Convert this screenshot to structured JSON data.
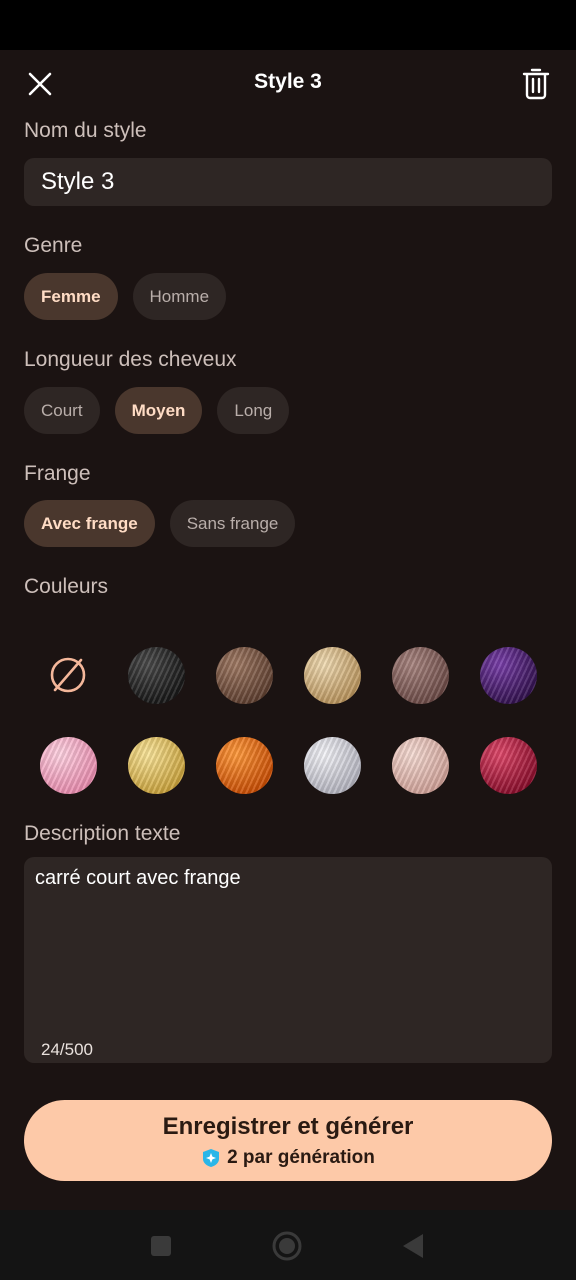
{
  "header": {
    "title": "Style 3",
    "close_icon": "close-icon",
    "delete_icon": "trash-icon"
  },
  "name_section": {
    "label": "Nom du style",
    "value": "Style 3"
  },
  "gender_section": {
    "label": "Genre",
    "options": [
      {
        "label": "Femme",
        "selected": true
      },
      {
        "label": "Homme",
        "selected": false
      }
    ]
  },
  "length_section": {
    "label": "Longueur des cheveux",
    "options": [
      {
        "label": "Court",
        "selected": false
      },
      {
        "label": "Moyen",
        "selected": true
      },
      {
        "label": "Long",
        "selected": false
      }
    ]
  },
  "fringe_section": {
    "label": "Frange",
    "options": [
      {
        "label": "Avec frange",
        "selected": true
      },
      {
        "label": "Sans frange",
        "selected": false
      }
    ]
  },
  "colors_section": {
    "label": "Couleurs",
    "swatches": [
      {
        "name": "none",
        "icon": "no-color-icon",
        "color": "#f4b79a"
      },
      {
        "name": "black",
        "color": "#2a2a2a"
      },
      {
        "name": "brown",
        "color": "#7a5644"
      },
      {
        "name": "blonde",
        "color": "#d9b98a"
      },
      {
        "name": "ash-brown",
        "color": "#8a6560"
      },
      {
        "name": "purple",
        "color": "#4d1f73"
      },
      {
        "name": "pink",
        "color": "#f2a9c4"
      },
      {
        "name": "golden",
        "color": "#e6c55e"
      },
      {
        "name": "orange",
        "color": "#ea6a12"
      },
      {
        "name": "silver",
        "color": "#d7d7df"
      },
      {
        "name": "rose-gold",
        "color": "#e6c1b8"
      },
      {
        "name": "burgundy",
        "color": "#b0173c"
      }
    ]
  },
  "description_section": {
    "label": "Description texte",
    "value": "carré court avec frange",
    "counter": "24/500"
  },
  "cta": {
    "label": "Enregistrer et générer",
    "cost_text": "2 par génération",
    "cost_icon": "credit-gem-icon"
  },
  "colors": {
    "background": "#1b1312",
    "surface": "#2e2624",
    "chip_selected": "#4a372d",
    "accent": "#fdc9a8"
  }
}
